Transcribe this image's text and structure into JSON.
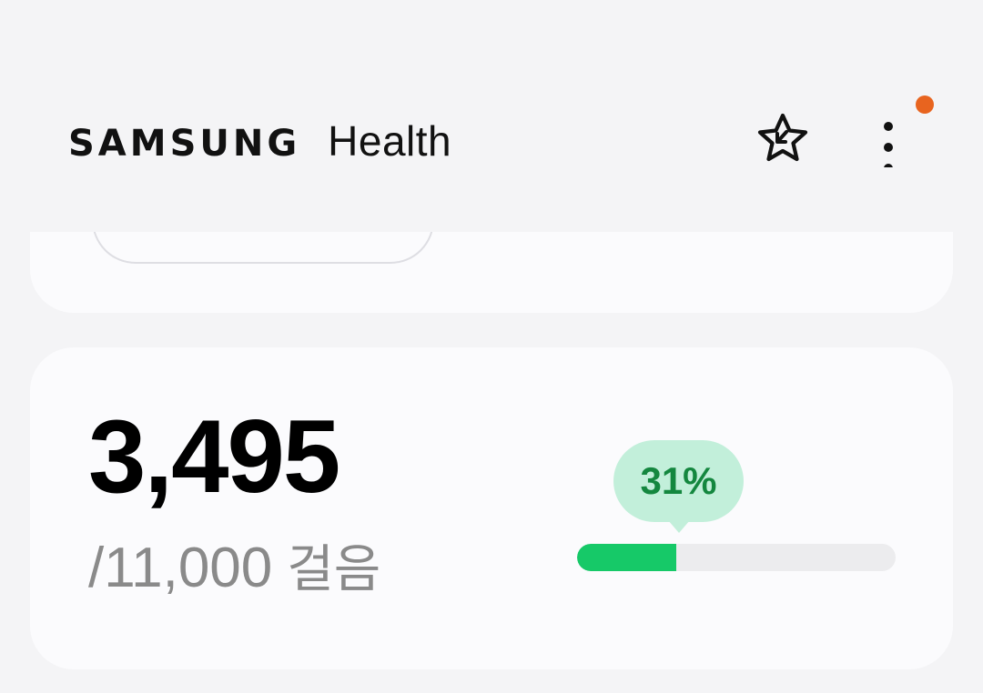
{
  "header": {
    "brand_logo": "SAMSUNG",
    "brand_product": "Health",
    "favorite_icon": "star-with-arrow-icon",
    "more_icon": "more-vertical-icon",
    "notification_color": "#e8641f"
  },
  "steps": {
    "count": "3,495",
    "goal": "/11,000",
    "unit": "걸음",
    "progress_label": "31%",
    "progress_fraction": 0.31,
    "accent_color": "#16c968",
    "bubble_color": "#c2efda",
    "bubble_text_color": "#14873f"
  }
}
